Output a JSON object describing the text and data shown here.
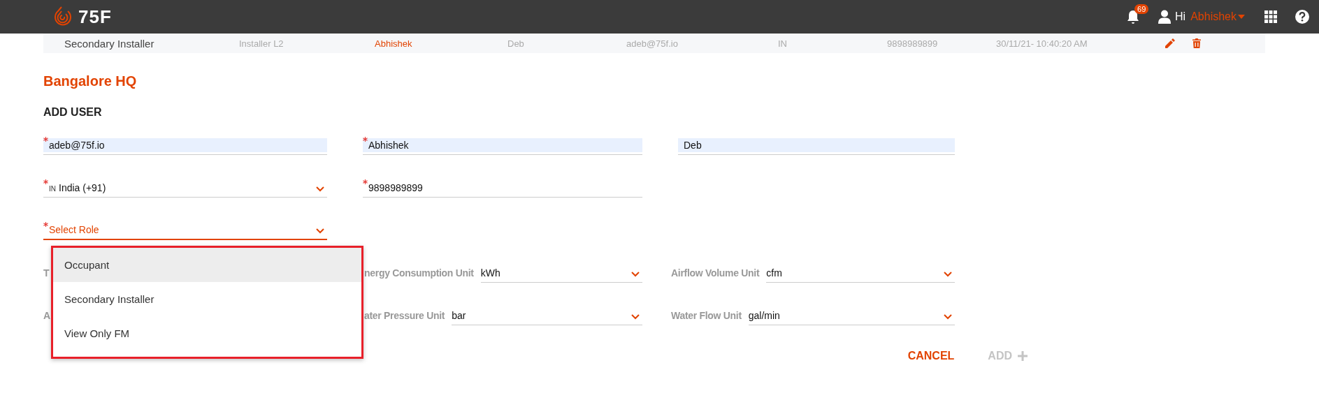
{
  "header": {
    "logo": "75F",
    "notifications": "69",
    "greeting": "Hi",
    "user": "Abhishek"
  },
  "user_row": {
    "cells": [
      {
        "kind": "role",
        "text": "Secondary Installer"
      },
      {
        "kind": "plain",
        "text": "Installer L2"
      },
      {
        "kind": "name",
        "text": "Abhishek"
      },
      {
        "kind": "plain",
        "text": "Deb"
      },
      {
        "kind": "plain",
        "text": "adeb@75f.io"
      },
      {
        "kind": "plain",
        "text": "IN"
      },
      {
        "kind": "plain",
        "text": "9898989899"
      },
      {
        "kind": "plain",
        "text": "30/11/21- 10:40:20 AM"
      }
    ]
  },
  "site": "Bangalore HQ",
  "form": {
    "title": "ADD USER",
    "fields": [
      {
        "kind": "input",
        "required": true,
        "autofilled": true,
        "value": "adeb@75f.io"
      },
      {
        "kind": "input",
        "required": true,
        "autofilled": true,
        "value": "Abhishek"
      },
      {
        "kind": "input",
        "required": false,
        "autofilled": true,
        "value": "Deb"
      },
      {
        "kind": "select",
        "required": true,
        "prefix": "IN",
        "value": "India (+91)"
      },
      {
        "kind": "input",
        "required": true,
        "autofilled": false,
        "value": "9898989899"
      },
      {
        "kind": "gap"
      },
      {
        "kind": "select",
        "required": true,
        "focused": true,
        "placeholder": "Select Role"
      }
    ],
    "units": [
      {
        "label": "T"
      },
      {
        "label": "nergy Consumption Unit",
        "value": "kWh"
      },
      {
        "label": "Airflow Volume Unit",
        "value": "cfm"
      },
      {
        "label": "A"
      },
      {
        "label": "ater Pressure Unit",
        "value": "bar"
      },
      {
        "label": "Water Flow Unit",
        "value": "gal/min"
      }
    ],
    "dropdown": {
      "highlighted": true,
      "options": [
        {
          "label": "Occupant",
          "selected": true
        },
        {
          "label": "Secondary Installer",
          "selected": false
        },
        {
          "label": "View Only FM",
          "selected": false
        }
      ]
    },
    "buttons": [
      {
        "label": "CANCEL",
        "disabled": false,
        "icon": false
      },
      {
        "label": "ADD",
        "disabled": true,
        "icon": true
      }
    ]
  }
}
